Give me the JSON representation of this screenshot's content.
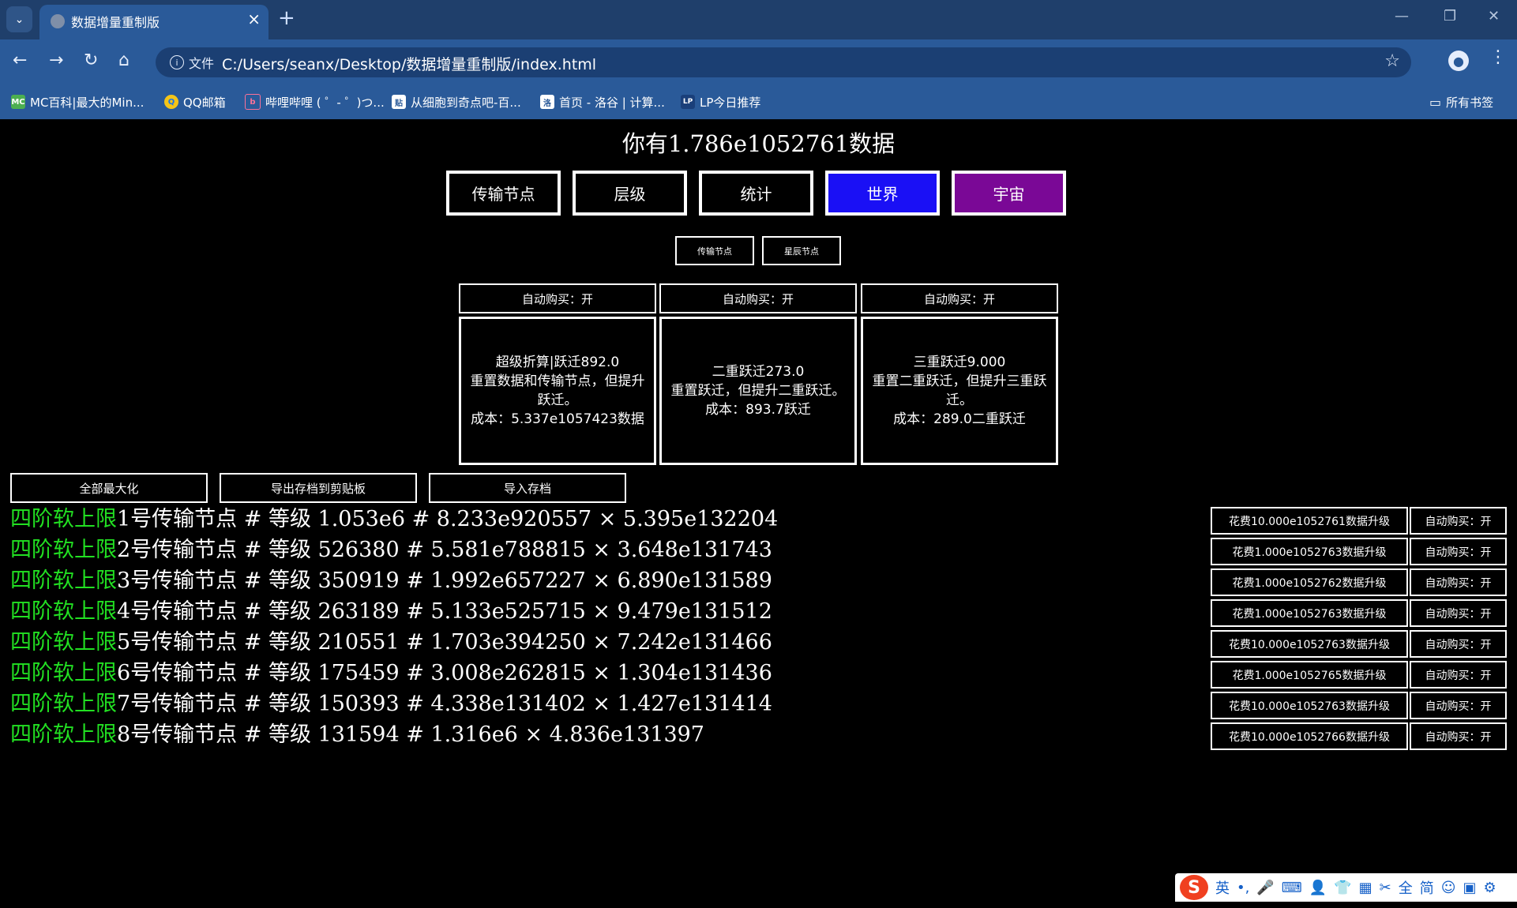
{
  "browser": {
    "tab_title": "数据增量重制版",
    "site_info_label": "文件",
    "url": "C:/Users/seanx/Desktop/数据增量重制版/index.html",
    "bookmarks": [
      {
        "icon": "MC",
        "label": "MC百科|最大的Min..."
      },
      {
        "icon": "Q",
        "label": "QQ邮箱"
      },
      {
        "icon": "b",
        "label": "哔哩哔哩 ( ゜- ゜)つ..."
      },
      {
        "icon": "贴",
        "label": "从细胞到奇点吧-百..."
      },
      {
        "icon": "洛",
        "label": "首页 - 洛谷 | 计算..."
      },
      {
        "icon": "LP",
        "label": "LP今日推荐"
      }
    ],
    "all_bookmarks_label": "所有书签"
  },
  "game": {
    "headline": "你有1.786e1052761数据",
    "tabs": [
      "传输节点",
      "层级",
      "统计",
      "世界",
      "宇宙"
    ],
    "tab_colors": [
      "#000000",
      "#000000",
      "#000000",
      "#1a10f5",
      "#7a0896"
    ],
    "subtabs": [
      "传输节点",
      "星辰节点"
    ],
    "jump_auto": [
      "自动购买：开",
      "自动购买：开",
      "自动购买：开"
    ],
    "jumps": [
      {
        "title": "超级折算|跃迁892.0",
        "desc": "重置数据和传输节点，但提升跃迁。",
        "cost": "成本：5.337e1057423数据"
      },
      {
        "title": "二重跃迁273.0",
        "desc": "重置跃迁，但提升二重跃迁。",
        "cost": "成本：893.7跃迁"
      },
      {
        "title": "三重跃迁9.000",
        "desc": "重置二重跃迁，但提升三重跃迁。",
        "cost": "成本：289.0二重跃迁"
      }
    ],
    "actions": [
      "全部最大化",
      "导出存档到剪贴板",
      "导入存档"
    ],
    "nodes": [
      {
        "prefix": "四阶软上限",
        "text": "1号传输节点 # 等级 1.053e6 # 8.233e920557 × 5.395e132204",
        "cost": "花费10.000e1052761数据升级",
        "auto": "自动购买：开"
      },
      {
        "prefix": "四阶软上限",
        "text": "2号传输节点 # 等级 526380 # 5.581e788815 × 3.648e131743",
        "cost": "花费1.000e1052763数据升级",
        "auto": "自动购买：开"
      },
      {
        "prefix": "四阶软上限",
        "text": "3号传输节点 # 等级 350919 # 1.992e657227 × 6.890e131589",
        "cost": "花费1.000e1052762数据升级",
        "auto": "自动购买：开"
      },
      {
        "prefix": "四阶软上限",
        "text": "4号传输节点 # 等级 263189 # 5.133e525715 × 9.479e131512",
        "cost": "花费1.000e1052763数据升级",
        "auto": "自动购买：开"
      },
      {
        "prefix": "四阶软上限",
        "text": "5号传输节点 # 等级 210551 # 1.703e394250 × 7.242e131466",
        "cost": "花费10.000e1052763数据升级",
        "auto": "自动购买：开"
      },
      {
        "prefix": "四阶软上限",
        "text": "6号传输节点 # 等级 175459 # 3.008e262815 × 1.304e131436",
        "cost": "花费1.000e1052765数据升级",
        "auto": "自动购买：开"
      },
      {
        "prefix": "四阶软上限",
        "text": "7号传输节点 # 等级 150393 # 4.338e131402 × 1.427e131414",
        "cost": "花费10.000e1052763数据升级",
        "auto": "自动购买：开"
      },
      {
        "prefix": "四阶软上限",
        "text": "8号传输节点 # 等级 131594 # 1.316e6 × 4.836e131397",
        "cost": "花费10.000e1052766数据升级",
        "auto": "自动购买：开"
      }
    ]
  },
  "ime": {
    "logo": "S",
    "items": [
      "英",
      "•,",
      "🎤",
      "⌨",
      "👤",
      "👕",
      "▦",
      "✂",
      "全",
      "简",
      "☺",
      "▣",
      "⚙"
    ]
  }
}
